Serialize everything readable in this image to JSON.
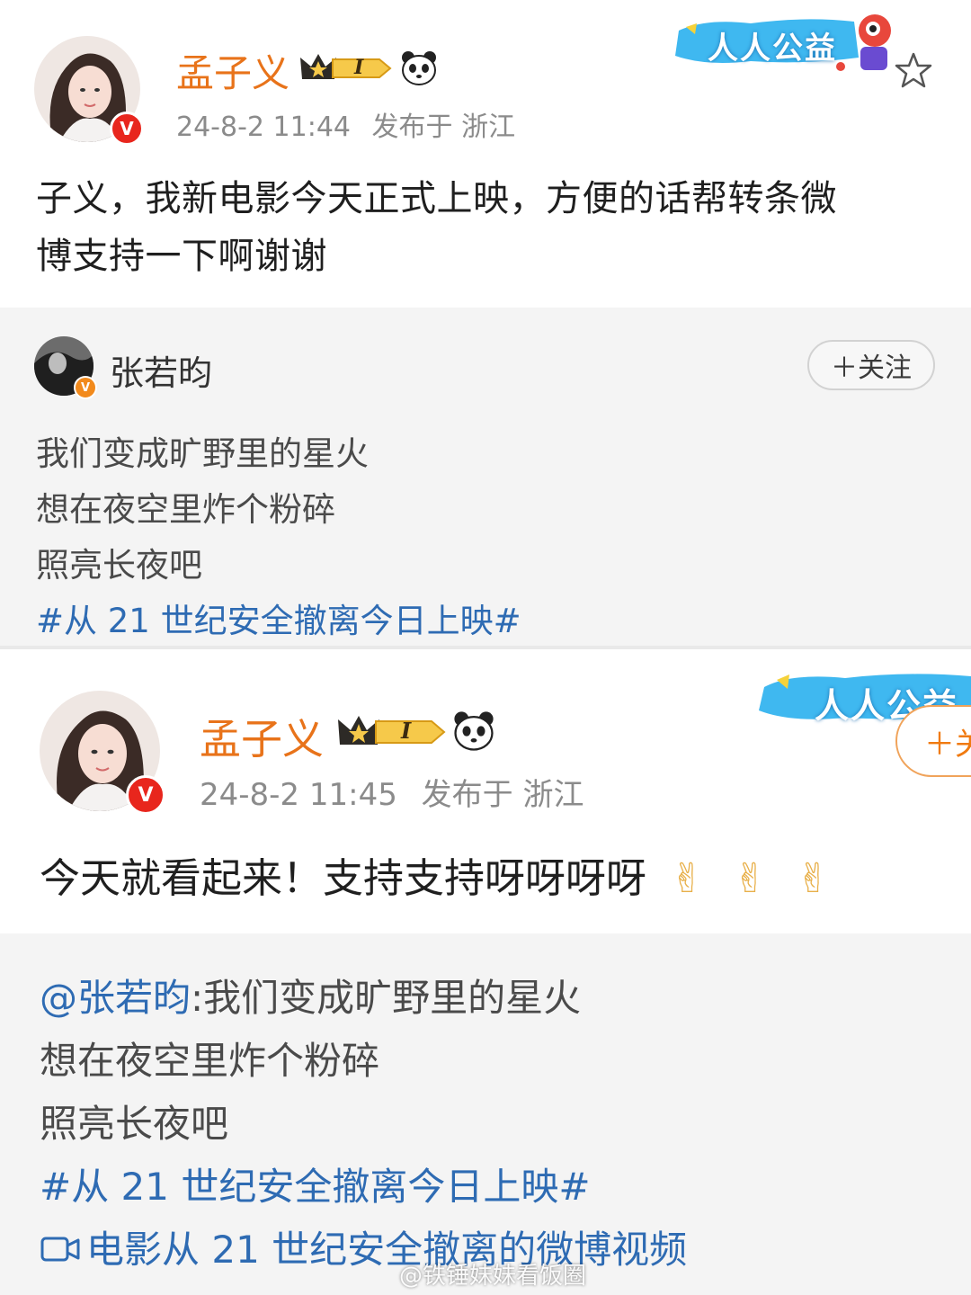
{
  "post1": {
    "username": "孟子义",
    "rank": "I",
    "time": "24-8-2 11:44",
    "location": "发布于 浙江",
    "text_line1": "子义，我新电影今天正式上映，方便的话帮转条微",
    "text_line2": "博支持一下啊谢谢",
    "banner": "人人公益",
    "repost": {
      "username": "张若昀",
      "follow": "＋关注",
      "lines": [
        "我们变成旷野里的星火",
        "想在夜空里炸个粉碎",
        "照亮长夜吧"
      ],
      "hashtag": "#从 21 世纪安全撤离今日上映#"
    }
  },
  "post2": {
    "username": "孟子义",
    "rank": "I",
    "time": "24-8-2 11:45",
    "location": "发布于 浙江",
    "text": "今天就看起来！支持支持呀呀呀呀",
    "emoji": [
      "✌",
      "✌",
      "✌"
    ],
    "banner": "人人公益",
    "follow": "＋关",
    "repost": {
      "mention": "@张若昀",
      "first_line": ":我们变成旷野里的星火",
      "lines": [
        "想在夜空里炸个粉碎",
        "照亮长夜吧"
      ],
      "hashtag": "#从 21 世纪安全撤离今日上映#",
      "video_link": "电影从 21 世纪安全撤离的微博视频"
    }
  },
  "watermark": "@铁锤妹妹看饭圈",
  "colors": {
    "username": "#e8731a",
    "link": "#2e6bb3",
    "verified": "#e8261d",
    "meta": "#8b8b8b"
  }
}
